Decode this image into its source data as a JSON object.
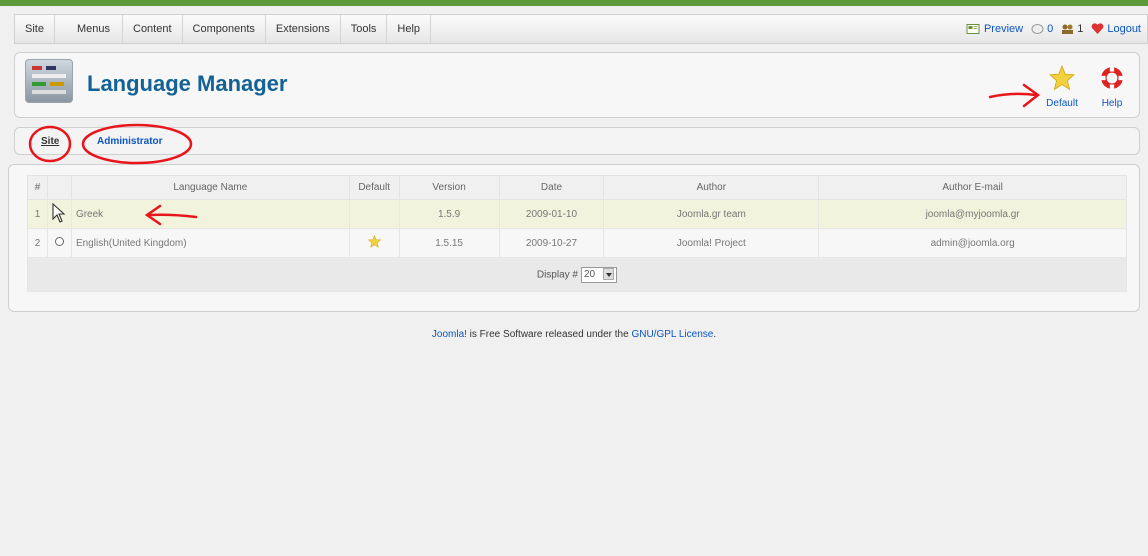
{
  "menu": {
    "items": [
      {
        "label": "Site"
      },
      {
        "label": "Menus"
      },
      {
        "label": "Content"
      },
      {
        "label": "Components"
      },
      {
        "label": "Extensions"
      },
      {
        "label": "Tools"
      },
      {
        "label": "Help"
      }
    ]
  },
  "status": {
    "preview": "Preview",
    "messages": "0",
    "users": "1",
    "logout": "Logout"
  },
  "header": {
    "title": "Language Manager",
    "toolbar": {
      "default_label": "Default",
      "help_label": "Help"
    }
  },
  "submenu": {
    "site": "Site",
    "administrator": "Administrator"
  },
  "table": {
    "headers": [
      "#",
      "",
      "Language Name",
      "Default",
      "Version",
      "Date",
      "Author",
      "Author E-mail"
    ],
    "rows": [
      {
        "num": "1",
        "name": "Greek",
        "default": "",
        "version": "1.5.9",
        "date": "2009-01-10",
        "author": "Joomla.gr team",
        "email": "joomla@myjoomla.gr"
      },
      {
        "num": "2",
        "name": "English(United Kingdom)",
        "default": "star",
        "version": "1.5.15",
        "date": "2009-10-27",
        "author": "Joomla! Project",
        "email": "admin@joomla.org"
      }
    ],
    "display_label": "Display #",
    "display_value": "20"
  },
  "footer": {
    "joomla_link": "Joomla!",
    "text": " is Free Software released under the ",
    "license_link": "GNU/GPL License",
    "end": "."
  },
  "colors": {
    "title": "#146295",
    "link": "#0b55c4",
    "annotation": "#e8161a",
    "star": "#f2c94c"
  }
}
